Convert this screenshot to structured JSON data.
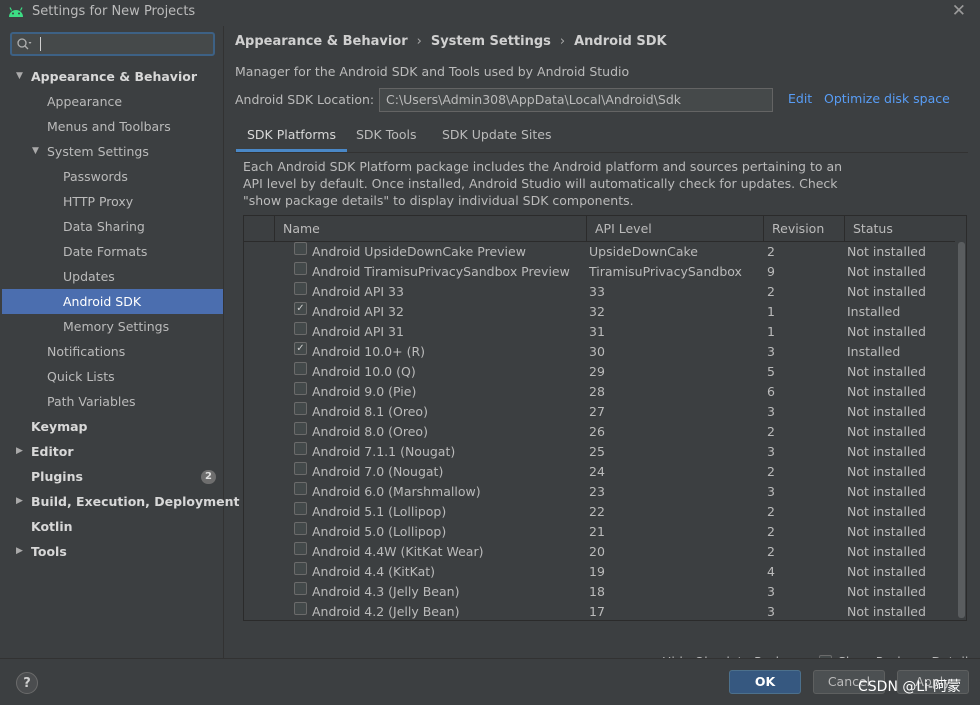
{
  "window": {
    "title": "Settings for New Projects",
    "close_glyph": "✕"
  },
  "sidebar": {
    "search": {
      "placeholder": "",
      "value": ""
    },
    "items": [
      {
        "label": "Appearance & Behavior",
        "expanded": true
      },
      {
        "label": "Appearance"
      },
      {
        "label": "Menus and Toolbars"
      },
      {
        "label": "System Settings",
        "expanded": true
      },
      {
        "label": "Passwords"
      },
      {
        "label": "HTTP Proxy"
      },
      {
        "label": "Data Sharing"
      },
      {
        "label": "Date Formats"
      },
      {
        "label": "Updates"
      },
      {
        "label": "Android SDK",
        "selected": true
      },
      {
        "label": "Memory Settings"
      },
      {
        "label": "Notifications"
      },
      {
        "label": "Quick Lists"
      },
      {
        "label": "Path Variables"
      },
      {
        "label": "Keymap"
      },
      {
        "label": "Editor"
      },
      {
        "label": "Plugins",
        "badge": "2"
      },
      {
        "label": "Build, Execution, Deployment"
      },
      {
        "label": "Kotlin"
      },
      {
        "label": "Tools"
      }
    ]
  },
  "main": {
    "breadcrumb": [
      "Appearance & Behavior",
      "System Settings",
      "Android SDK"
    ],
    "breadcrumb_sep": "›",
    "description": "Manager for the Android SDK and Tools used by Android Studio",
    "location_label": "Android SDK Location:",
    "location_value": "C:\\Users\\Admin308\\AppData\\Local\\Android\\Sdk",
    "edit_link": "Edit",
    "optimize_link": "Optimize disk space",
    "tabs": [
      "SDK Platforms",
      "SDK Tools",
      "SDK Update Sites"
    ],
    "active_tab": "SDK Platforms",
    "panel_description": "Each Android SDK Platform package includes the Android platform and sources pertaining to an API level by default. Once installed, Android Studio will automatically check for updates. Check \"show package details\" to display individual SDK components.",
    "table": {
      "columns": [
        "Name",
        "API Level",
        "Revision",
        "Status"
      ],
      "rows": [
        {
          "checked": false,
          "name": "Android UpsideDownCake Preview",
          "api": "UpsideDownCake",
          "revision": "2",
          "status": "Not installed"
        },
        {
          "checked": false,
          "name": "Android TiramisuPrivacySandbox Preview",
          "api": "TiramisuPrivacySandbox",
          "revision": "9",
          "status": "Not installed"
        },
        {
          "checked": false,
          "name": "Android API 33",
          "api": "33",
          "revision": "2",
          "status": "Not installed"
        },
        {
          "checked": true,
          "name": "Android API 32",
          "api": "32",
          "revision": "1",
          "status": "Installed"
        },
        {
          "checked": false,
          "name": "Android API 31",
          "api": "31",
          "revision": "1",
          "status": "Not installed"
        },
        {
          "checked": true,
          "name": "Android 10.0+ (R)",
          "api": "30",
          "revision": "3",
          "status": "Installed"
        },
        {
          "checked": false,
          "name": "Android 10.0 (Q)",
          "api": "29",
          "revision": "5",
          "status": "Not installed"
        },
        {
          "checked": false,
          "name": "Android 9.0 (Pie)",
          "api": "28",
          "revision": "6",
          "status": "Not installed"
        },
        {
          "checked": false,
          "name": "Android 8.1 (Oreo)",
          "api": "27",
          "revision": "3",
          "status": "Not installed"
        },
        {
          "checked": false,
          "name": "Android 8.0 (Oreo)",
          "api": "26",
          "revision": "2",
          "status": "Not installed"
        },
        {
          "checked": false,
          "name": "Android 7.1.1 (Nougat)",
          "api": "25",
          "revision": "3",
          "status": "Not installed"
        },
        {
          "checked": false,
          "name": "Android 7.0 (Nougat)",
          "api": "24",
          "revision": "2",
          "status": "Not installed"
        },
        {
          "checked": false,
          "name": "Android 6.0 (Marshmallow)",
          "api": "23",
          "revision": "3",
          "status": "Not installed"
        },
        {
          "checked": false,
          "name": "Android 5.1 (Lollipop)",
          "api": "22",
          "revision": "2",
          "status": "Not installed"
        },
        {
          "checked": false,
          "name": "Android 5.0 (Lollipop)",
          "api": "21",
          "revision": "2",
          "status": "Not installed"
        },
        {
          "checked": false,
          "name": "Android 4.4W (KitKat Wear)",
          "api": "20",
          "revision": "2",
          "status": "Not installed"
        },
        {
          "checked": false,
          "name": "Android 4.4 (KitKat)",
          "api": "19",
          "revision": "4",
          "status": "Not installed"
        },
        {
          "checked": false,
          "name": "Android 4.3 (Jelly Bean)",
          "api": "18",
          "revision": "3",
          "status": "Not installed"
        },
        {
          "checked": false,
          "name": "Android 4.2 (Jelly Bean)",
          "api": "17",
          "revision": "3",
          "status": "Not installed"
        }
      ]
    },
    "hide_obsolete": {
      "label": "Hide Obsolete Packages",
      "checked": true
    },
    "show_details": {
      "label": "Show Package Details",
      "checked": false
    }
  },
  "footer": {
    "help": "?",
    "ok": "OK",
    "cancel": "Cancel",
    "apply": "Apply"
  },
  "watermark": "CSDN @Li-阿蒙",
  "colors": {
    "background": "#3c3f41",
    "selection": "#4b6eaf",
    "link": "#589df6",
    "primary_button": "#365880"
  },
  "icons": {
    "app": "android-icon",
    "search": "search-icon",
    "help": "help-icon",
    "close": "close-icon"
  }
}
